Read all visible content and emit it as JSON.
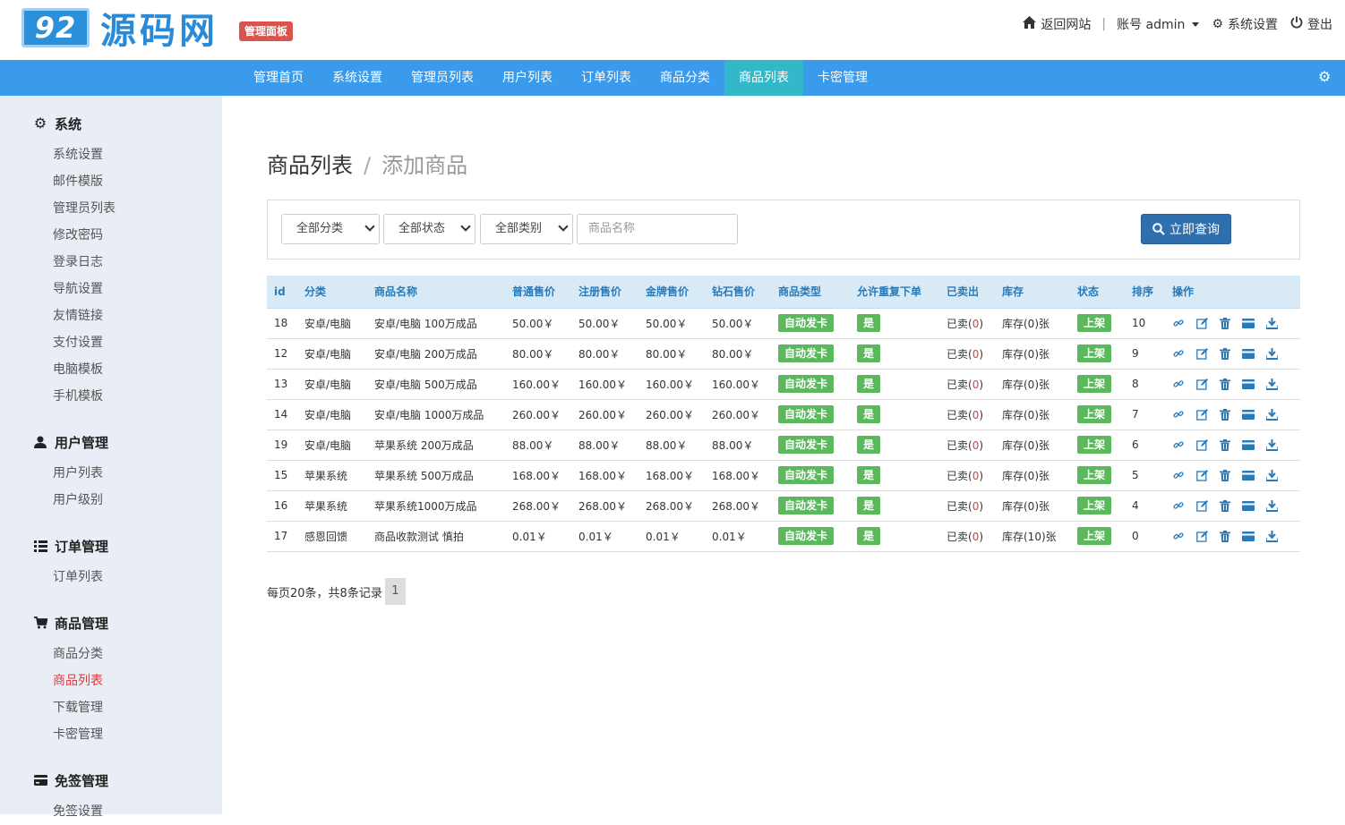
{
  "header": {
    "logo_badge": "92",
    "logo_text": "源码网",
    "admin_tag": "管理面板",
    "links": {
      "home": "返回网站",
      "account": "账号 admin",
      "settings": "系统设置",
      "logout": "登出"
    }
  },
  "nav": {
    "items": [
      "管理首页",
      "系统设置",
      "管理员列表",
      "用户列表",
      "订单列表",
      "商品分类",
      "商品列表",
      "卡密管理"
    ],
    "active": "商品列表"
  },
  "sidebar": {
    "groups": [
      {
        "title": "系统",
        "icon": "gear-icon",
        "items": [
          "系统设置",
          "邮件模版",
          "管理员列表",
          "修改密码",
          "登录日志",
          "导航设置",
          "友情链接",
          "支付设置",
          "电脑模板",
          "手机模板"
        ]
      },
      {
        "title": "用户管理",
        "icon": "user-icon",
        "items": [
          "用户列表",
          "用户级别"
        ]
      },
      {
        "title": "订单管理",
        "icon": "list-icon",
        "items": [
          "订单列表"
        ]
      },
      {
        "title": "商品管理",
        "icon": "cart-icon",
        "items": [
          "商品分类",
          "商品列表",
          "下载管理",
          "卡密管理"
        ]
      },
      {
        "title": "免签管理",
        "icon": "card-icon",
        "items": [
          "免签设置"
        ]
      }
    ],
    "active": "商品列表"
  },
  "breadcrumb": {
    "title": "商品列表",
    "sep": "/",
    "current": "添加商品"
  },
  "filter": {
    "category": "全部分类",
    "status": "全部状态",
    "type": "全部类别",
    "name_placeholder": "商品名称",
    "query_label": "立即查询"
  },
  "table": {
    "headers": [
      "id",
      "分类",
      "商品名称",
      "普通售价",
      "注册售价",
      "金牌售价",
      "钻石售价",
      "商品类型",
      "允许重复下单",
      "已卖出",
      "库存",
      "状态",
      "排序",
      "操作"
    ],
    "rows": [
      {
        "id": "18",
        "cat": "安卓/电脑",
        "name": "安卓/电脑 100万成品",
        "p1": "50.00￥",
        "p2": "50.00￥",
        "p3": "50.00￥",
        "p4": "50.00￥",
        "type": "自动发卡",
        "repeat": "是",
        "sold_pre": "已卖(",
        "sold": "0",
        "sold_post": ")",
        "stock": "库存(0)张",
        "status": "上架",
        "sort": "10"
      },
      {
        "id": "12",
        "cat": "安卓/电脑",
        "name": "安卓/电脑 200万成品",
        "p1": "80.00￥",
        "p2": "80.00￥",
        "p3": "80.00￥",
        "p4": "80.00￥",
        "type": "自动发卡",
        "repeat": "是",
        "sold_pre": "已卖(",
        "sold": "0",
        "sold_post": ")",
        "stock": "库存(0)张",
        "status": "上架",
        "sort": "9"
      },
      {
        "id": "13",
        "cat": "安卓/电脑",
        "name": "安卓/电脑 500万成品",
        "p1": "160.00￥",
        "p2": "160.00￥",
        "p3": "160.00￥",
        "p4": "160.00￥",
        "type": "自动发卡",
        "repeat": "是",
        "sold_pre": "已卖(",
        "sold": "0",
        "sold_post": ")",
        "stock": "库存(0)张",
        "status": "上架",
        "sort": "8"
      },
      {
        "id": "14",
        "cat": "安卓/电脑",
        "name": "安卓/电脑 1000万成品",
        "p1": "260.00￥",
        "p2": "260.00￥",
        "p3": "260.00￥",
        "p4": "260.00￥",
        "type": "自动发卡",
        "repeat": "是",
        "sold_pre": "已卖(",
        "sold": "0",
        "sold_post": ")",
        "stock": "库存(0)张",
        "status": "上架",
        "sort": "7"
      },
      {
        "id": "19",
        "cat": "安卓/电脑",
        "name": "苹果系统 200万成品",
        "p1": "88.00￥",
        "p2": "88.00￥",
        "p3": "88.00￥",
        "p4": "88.00￥",
        "type": "自动发卡",
        "repeat": "是",
        "sold_pre": "已卖(",
        "sold": "0",
        "sold_post": ")",
        "stock": "库存(0)张",
        "status": "上架",
        "sort": "6"
      },
      {
        "id": "15",
        "cat": "苹果系统",
        "name": "苹果系统 500万成品",
        "p1": "168.00￥",
        "p2": "168.00￥",
        "p3": "168.00￥",
        "p4": "168.00￥",
        "type": "自动发卡",
        "repeat": "是",
        "sold_pre": "已卖(",
        "sold": "0",
        "sold_post": ")",
        "stock": "库存(0)张",
        "status": "上架",
        "sort": "5"
      },
      {
        "id": "16",
        "cat": "苹果系统",
        "name": "苹果系统1000万成品",
        "p1": "268.00￥",
        "p2": "268.00￥",
        "p3": "268.00￥",
        "p4": "268.00￥",
        "type": "自动发卡",
        "repeat": "是",
        "sold_pre": "已卖(",
        "sold": "0",
        "sold_post": ")",
        "stock": "库存(0)张",
        "status": "上架",
        "sort": "4"
      },
      {
        "id": "17",
        "cat": "感恩回馈",
        "name": "商品收款测试 慎拍",
        "p1": "0.01￥",
        "p2": "0.01￥",
        "p3": "0.01￥",
        "p4": "0.01￥",
        "type": "自动发卡",
        "repeat": "是",
        "sold_pre": "已卖(",
        "sold": "0",
        "sold_post": ")",
        "stock": "库存(10)张",
        "status": "上架",
        "sort": "0"
      }
    ],
    "ops": [
      "link-icon",
      "edit-icon",
      "delete-icon",
      "card-icon",
      "export-icon"
    ]
  },
  "pager": {
    "summary": "每页20条，共8条记录",
    "page": "1"
  },
  "colors": {
    "nav": "#3a9bea",
    "nav_active": "#33b8c9",
    "label_green": "#5cb85c",
    "btn": "#2f6fae",
    "sidebar": "#e9edf5"
  }
}
